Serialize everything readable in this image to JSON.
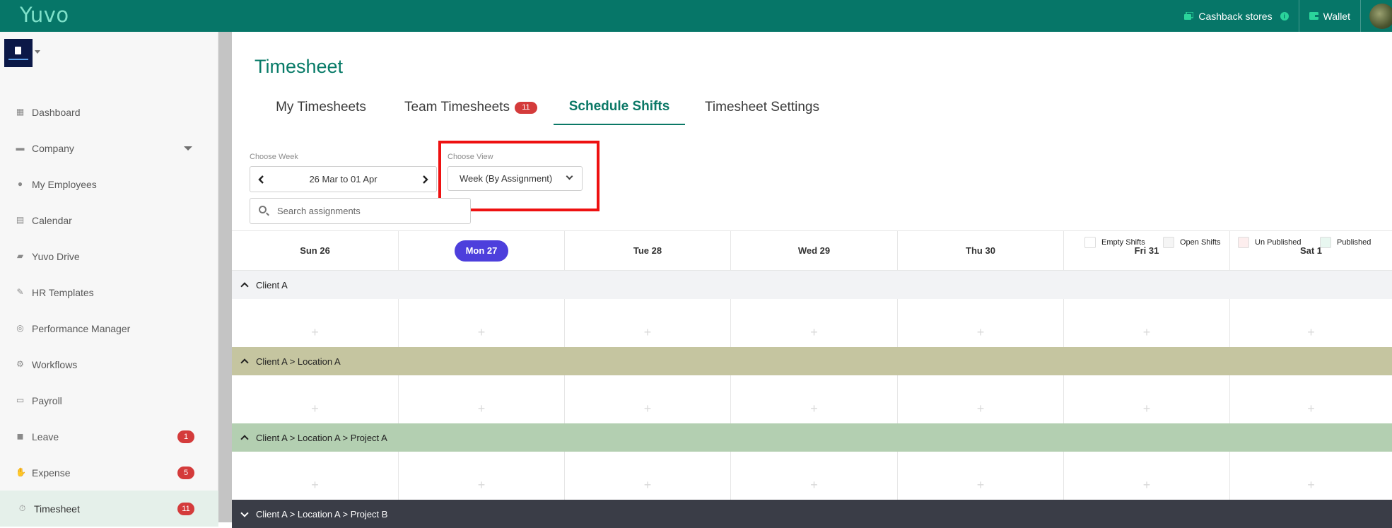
{
  "app": {
    "logo": "Yuvo"
  },
  "topbar": {
    "cashback_label": "Cashback stores",
    "info_icon": "i",
    "wallet_label": "Wallet"
  },
  "sidebar": {
    "items": [
      {
        "label": "Dashboard",
        "icon": "dashboard-icon"
      },
      {
        "label": "Company",
        "icon": "building-icon"
      },
      {
        "label": "My Employees",
        "icon": "users-icon"
      },
      {
        "label": "Calendar",
        "icon": "calendar-icon"
      },
      {
        "label": "Yuvo Drive",
        "icon": "folder-icon"
      },
      {
        "label": "HR Templates",
        "icon": "edit-icon"
      },
      {
        "label": "Performance Manager",
        "icon": "target-icon"
      },
      {
        "label": "Workflows",
        "icon": "gears-icon"
      },
      {
        "label": "Payroll",
        "icon": "payroll-icon"
      },
      {
        "label": "Leave",
        "icon": "suitcase-icon",
        "badge": "1"
      },
      {
        "label": "Expense",
        "icon": "hand-money-icon",
        "badge": "5"
      },
      {
        "label": "Timesheet",
        "icon": "stopwatch-icon",
        "badge": "11",
        "active": true
      }
    ]
  },
  "page": {
    "title": "Timesheet",
    "tabs": [
      {
        "label": "My Timesheets"
      },
      {
        "label": "Team Timesheets",
        "badge": "11"
      },
      {
        "label": "Schedule Shifts",
        "active": true
      },
      {
        "label": "Timesheet Settings"
      }
    ]
  },
  "controls": {
    "week_label": "Choose Week",
    "week_value": "26 Mar to 01 Apr",
    "view_label": "Choose View",
    "view_value": "Week (By Assignment)",
    "search_placeholder": "Search assignments"
  },
  "legend": [
    {
      "label": "Empty Shifts",
      "color": "#ffffff"
    },
    {
      "label": "Open Shifts",
      "color": "#f5f5f5"
    },
    {
      "label": "Un Published",
      "color": "#fdeeee"
    },
    {
      "label": "Published",
      "color": "#e8f7f0"
    }
  ],
  "schedule": {
    "days": [
      "Sun 26",
      "Mon 27",
      "Tue 28",
      "Wed 29",
      "Thu 30",
      "Fri 31",
      "Sat 1"
    ],
    "today": "Mon 27",
    "today_color": "#4d3fdc",
    "add_symbol": "+",
    "groups": [
      {
        "label": "Client A",
        "color": "#f2f3f5"
      },
      {
        "label": "Client A > Location A",
        "color": "#c5c5a0"
      },
      {
        "label": "Client A > Location A > Project A",
        "color": "#b3cfb1"
      },
      {
        "label": "Client A > Location A > Project B",
        "color": "#3a3d47"
      }
    ]
  },
  "colors": {
    "topbar": "#067668",
    "accent": "#0b7866",
    "badge": "#d43b3b",
    "highlight": "#ee1111"
  }
}
